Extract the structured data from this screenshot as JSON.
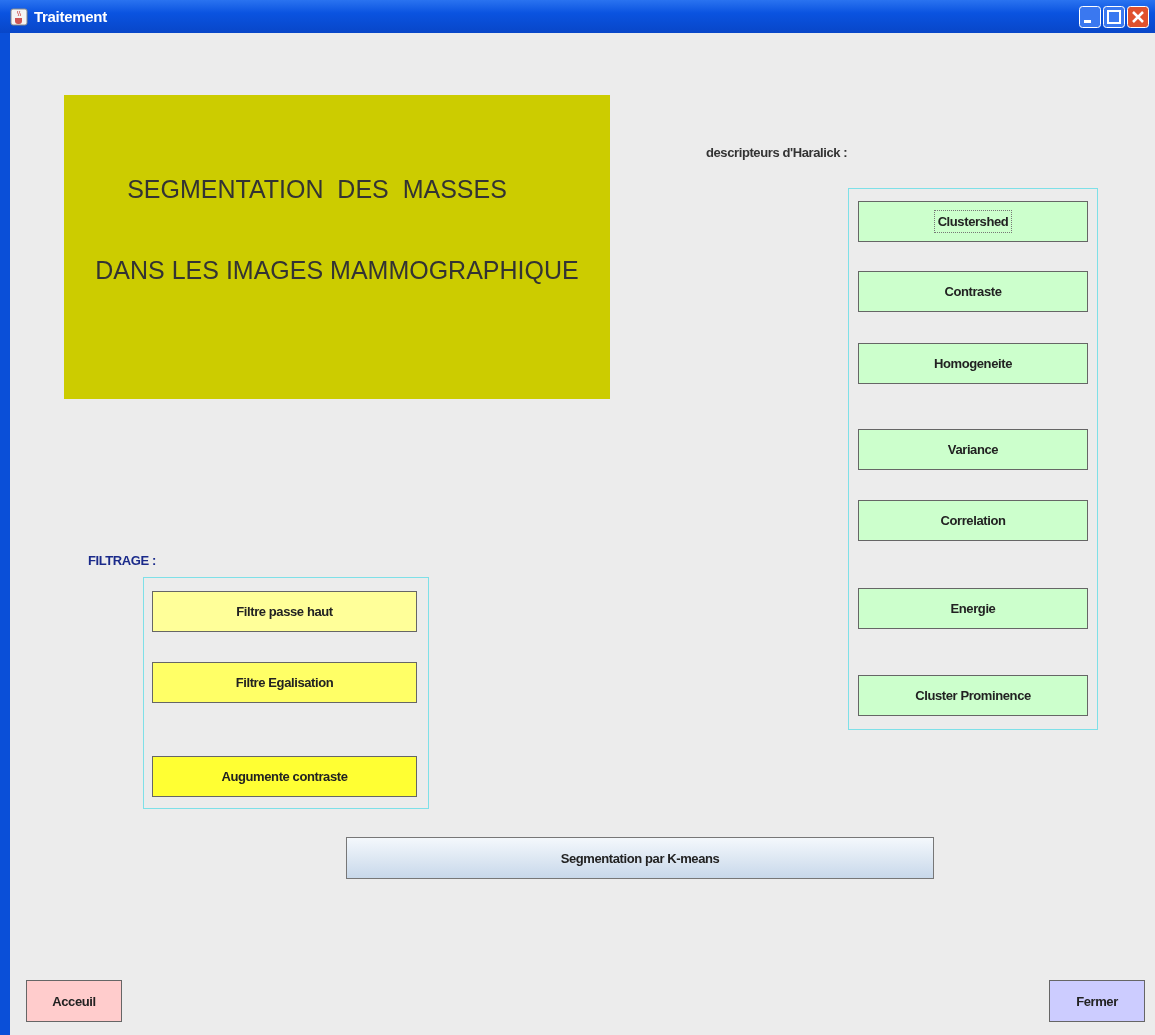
{
  "window": {
    "title": "Traitement"
  },
  "banner": {
    "lines": [
      "SEGMENTATION  DES  MASSES",
      "DANS LES IMAGES MAMMOGRAPHIQUE"
    ]
  },
  "filtrage": {
    "label": "FILTRAGE :",
    "buttons": [
      {
        "label": "Filtre passe haut",
        "color": "#ffff99",
        "focused": false
      },
      {
        "label": "Filtre Egalisation",
        "color": "#ffff66",
        "focused": false
      },
      {
        "label": "Augumente contraste",
        "color": "#ffff33",
        "focused": false
      }
    ]
  },
  "haralick": {
    "label": "descripteurs d'Haralick :",
    "buttons": [
      {
        "label": "Clustershed",
        "color": "#ccffcc",
        "focused": true
      },
      {
        "label": "Contraste",
        "color": "#ccffcc",
        "focused": false
      },
      {
        "label": "Homogeneite",
        "color": "#ccffcc",
        "focused": false
      },
      {
        "label": "Variance",
        "color": "#ccffcc",
        "focused": false
      },
      {
        "label": "Correlation",
        "color": "#ccffcc",
        "focused": false
      },
      {
        "label": "Energie",
        "color": "#ccffcc",
        "focused": false
      },
      {
        "label": "Cluster Prominence",
        "color": "#ccffcc",
        "focused": false
      }
    ]
  },
  "segment_button": "Segmentation par K-means",
  "footer": [
    {
      "label": "Acceuil",
      "color": "#ffcccc"
    },
    {
      "label": "Fermer",
      "color": "#ccccff"
    }
  ]
}
